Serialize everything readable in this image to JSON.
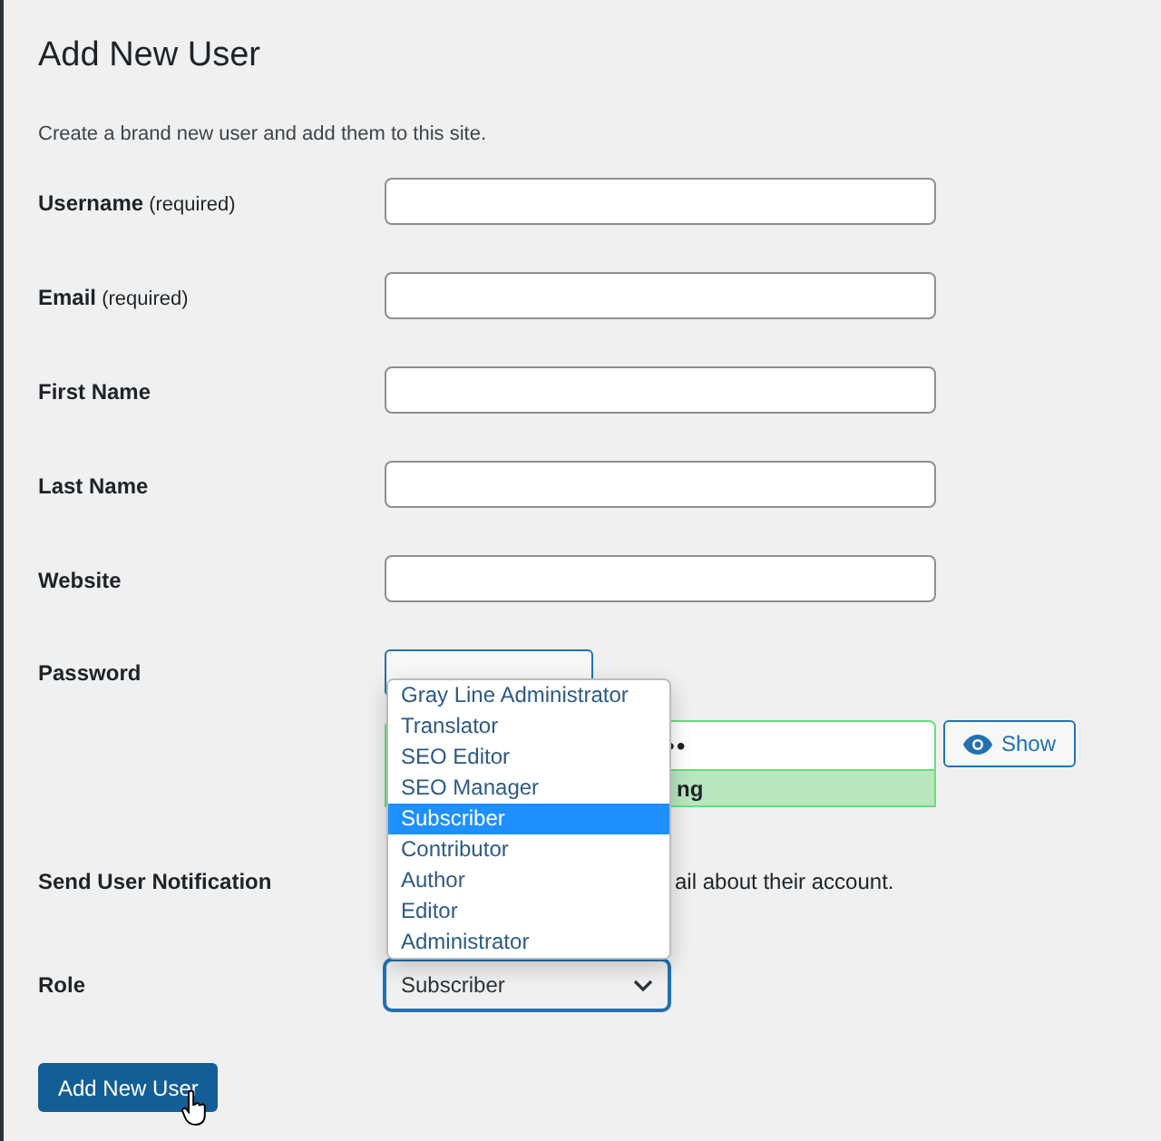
{
  "page": {
    "title": "Add New User",
    "description": "Create a brand new user and add them to this site."
  },
  "fields": [
    {
      "label": "Username",
      "hint": "(required)"
    },
    {
      "label": "Email",
      "hint": "(required)"
    },
    {
      "label": "First Name"
    },
    {
      "label": "Last Name"
    },
    {
      "label": "Website"
    }
  ],
  "password": {
    "label": "Password",
    "value": "••",
    "strength": "ng",
    "show_button": "Show"
  },
  "notification": {
    "label": "Send User Notification",
    "text": "ail about their account."
  },
  "role": {
    "label": "Role",
    "value": "Subscriber",
    "expanded": true,
    "options": [
      {
        "label": "Gray Line Administrator",
        "selected": false
      },
      {
        "label": "Translator",
        "selected": false
      },
      {
        "label": "SEO Editor",
        "selected": false
      },
      {
        "label": "SEO Manager",
        "selected": false
      },
      {
        "label": "Subscriber",
        "selected": true
      },
      {
        "label": "Contributor",
        "selected": false
      },
      {
        "label": "Author",
        "selected": false
      },
      {
        "label": "Editor",
        "selected": false
      },
      {
        "label": "Administrator",
        "selected": false
      }
    ]
  },
  "submit_button": "Add New User"
}
